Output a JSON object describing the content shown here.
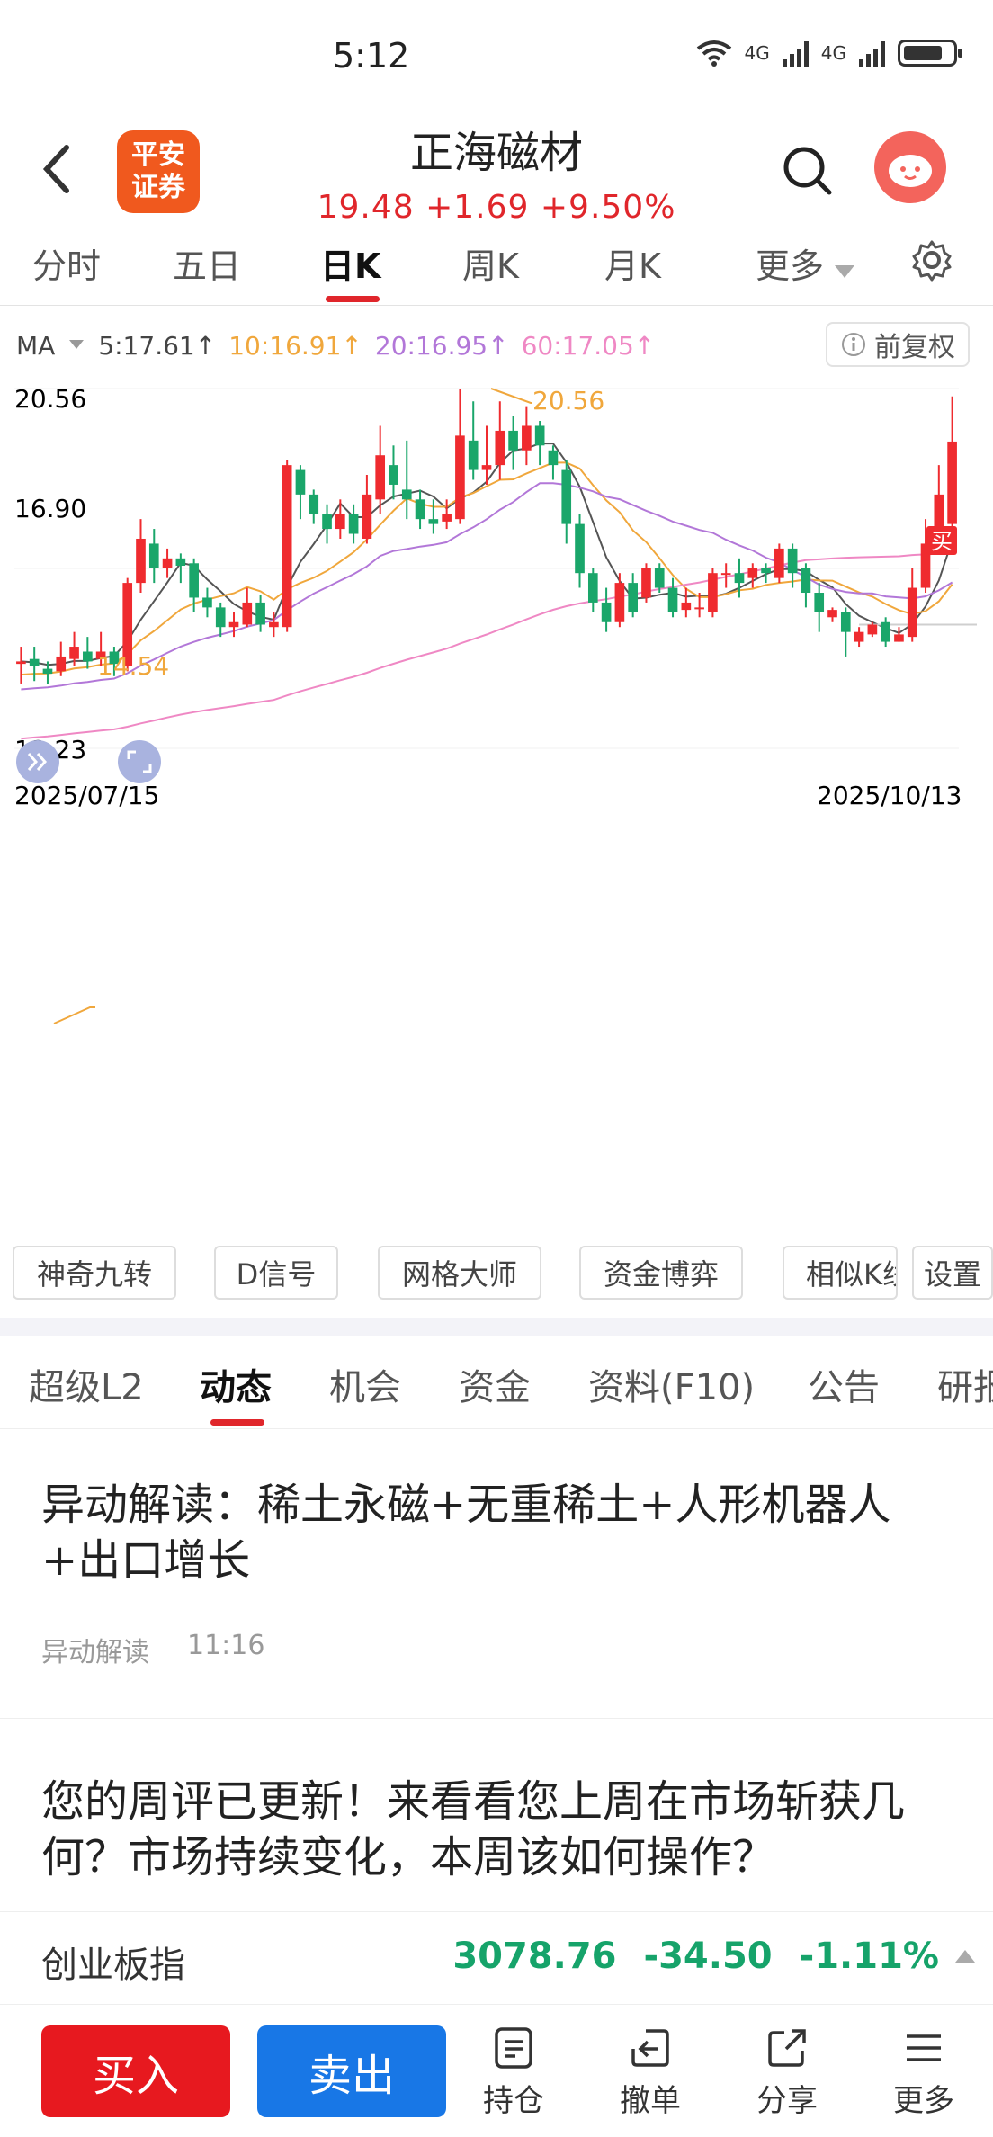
{
  "status_bar": {
    "time": "5:12",
    "net1": "4G",
    "net2": "4G"
  },
  "header": {
    "logo_text_line1": "平安",
    "logo_text_line2": "证券",
    "stock_name": "正海磁材",
    "price": "19.48",
    "change": "+1.69",
    "change_pct": "+9.50%"
  },
  "period_tabs": [
    "分时",
    "五日",
    "日K",
    "周K",
    "月K",
    "更多"
  ],
  "ma_bar": {
    "label": "MA",
    "ma5": "5:17.61↑",
    "ma10": "10:16.91↑",
    "ma20": "20:16.95↑",
    "ma60": "60:17.05↑",
    "fuquan": "前复权",
    "colors": {
      "ma5": "#555555",
      "ma10": "#f0a73c",
      "ma20": "#b277d8",
      "ma60": "#ef88c4"
    }
  },
  "chart_data": {
    "type": "candlestick",
    "title": "",
    "x_start": "2025/07/15",
    "x_end": "2025/10/13",
    "ylim": [
      13.23,
      20.56
    ],
    "y_ticks": [
      "20.56",
      "16.90",
      "13.23"
    ],
    "annotations": {
      "high": "20.56",
      "low": "14.54",
      "buy_marker": "买"
    },
    "colors": {
      "up": "#ef2b2f",
      "down": "#1aa66a"
    },
    "candles": [
      [
        14.95,
        15.0,
        14.55,
        15.3
      ],
      [
        15.05,
        14.9,
        14.6,
        15.3
      ],
      [
        14.85,
        14.75,
        14.54,
        15.0
      ],
      [
        14.8,
        15.1,
        14.7,
        15.4
      ],
      [
        15.05,
        15.3,
        14.9,
        15.6
      ],
      [
        15.2,
        15.0,
        14.85,
        15.5
      ],
      [
        15.05,
        15.2,
        14.9,
        15.6
      ],
      [
        15.2,
        14.95,
        14.7,
        15.3
      ],
      [
        14.9,
        16.6,
        14.8,
        16.7
      ],
      [
        16.6,
        17.5,
        16.4,
        17.9
      ],
      [
        17.4,
        16.9,
        16.6,
        17.7
      ],
      [
        16.9,
        17.1,
        16.7,
        17.3
      ],
      [
        17.1,
        16.95,
        16.6,
        17.2
      ],
      [
        17.0,
        16.3,
        16.0,
        17.1
      ],
      [
        16.3,
        16.1,
        15.9,
        16.5
      ],
      [
        16.1,
        15.7,
        15.5,
        16.2
      ],
      [
        15.7,
        15.8,
        15.5,
        16.0
      ],
      [
        15.75,
        16.2,
        15.7,
        16.5
      ],
      [
        16.2,
        15.75,
        15.6,
        16.35
      ],
      [
        15.7,
        15.8,
        15.5,
        16.0
      ],
      [
        15.7,
        19.0,
        15.6,
        19.1
      ],
      [
        18.9,
        18.4,
        17.9,
        19.0
      ],
      [
        18.4,
        18.0,
        17.8,
        18.5
      ],
      [
        18.0,
        17.7,
        17.4,
        18.2
      ],
      [
        17.7,
        18.0,
        17.5,
        18.3
      ],
      [
        18.0,
        17.6,
        17.4,
        18.2
      ],
      [
        17.5,
        18.4,
        17.4,
        18.8
      ],
      [
        18.3,
        19.2,
        18.0,
        19.8
      ],
      [
        19.0,
        18.6,
        18.3,
        19.4
      ],
      [
        18.5,
        18.3,
        17.9,
        19.5
      ],
      [
        18.3,
        17.9,
        17.7,
        18.5
      ],
      [
        17.9,
        17.8,
        17.6,
        18.3
      ],
      [
        17.85,
        18.0,
        17.7,
        18.3
      ],
      [
        17.9,
        19.6,
        17.8,
        20.56
      ],
      [
        19.5,
        18.9,
        18.7,
        20.3
      ],
      [
        18.9,
        19.0,
        18.6,
        19.8
      ],
      [
        19.0,
        19.7,
        18.7,
        20.3
      ],
      [
        19.7,
        19.3,
        18.9,
        20.0
      ],
      [
        19.3,
        19.8,
        19.0,
        20.2
      ],
      [
        19.8,
        19.4,
        19.0,
        19.9
      ],
      [
        19.3,
        19.0,
        18.7,
        19.4
      ],
      [
        18.9,
        17.8,
        17.4,
        19.1
      ],
      [
        17.8,
        16.8,
        16.5,
        18.0
      ],
      [
        16.8,
        16.2,
        16.0,
        16.9
      ],
      [
        16.2,
        15.8,
        15.6,
        16.5
      ],
      [
        15.8,
        16.6,
        15.7,
        16.8
      ],
      [
        16.6,
        16.0,
        15.9,
        16.8
      ],
      [
        16.3,
        16.9,
        16.2,
        17.0
      ],
      [
        16.9,
        16.5,
        16.4,
        17.0
      ],
      [
        16.5,
        16.0,
        15.9,
        16.7
      ],
      [
        16.05,
        16.2,
        15.9,
        16.5
      ],
      [
        16.1,
        16.1,
        15.9,
        16.4
      ],
      [
        16.0,
        16.8,
        15.9,
        16.9
      ],
      [
        16.8,
        16.8,
        16.5,
        17.0
      ],
      [
        16.8,
        16.6,
        16.3,
        17.1
      ],
      [
        16.7,
        16.9,
        16.5,
        17.0
      ],
      [
        16.9,
        16.8,
        16.6,
        17.0
      ],
      [
        16.7,
        17.3,
        16.6,
        17.4
      ],
      [
        17.3,
        16.8,
        16.5,
        17.4
      ],
      [
        16.9,
        16.4,
        16.1,
        17.0
      ],
      [
        16.4,
        16.0,
        15.6,
        16.6
      ],
      [
        15.9,
        16.05,
        15.8,
        16.1
      ],
      [
        16.0,
        15.6,
        15.1,
        16.1
      ],
      [
        15.4,
        15.6,
        15.3,
        15.7
      ],
      [
        15.55,
        15.75,
        15.5,
        15.8
      ],
      [
        15.8,
        15.4,
        15.3,
        15.9
      ],
      [
        15.4,
        15.55,
        15.4,
        15.7
      ],
      [
        15.5,
        16.5,
        15.4,
        16.9
      ],
      [
        16.5,
        17.4,
        16.4,
        17.9
      ],
      [
        17.4,
        18.4,
        17.3,
        19.0
      ],
      [
        17.8,
        19.48,
        17.6,
        20.4
      ]
    ]
  },
  "chart_tools": [
    "神奇九转",
    "D信号",
    "网格大师",
    "资金博弈",
    "相似K线",
    "设置"
  ],
  "content_tabs": [
    "超级L2",
    "动态",
    "机会",
    "资金",
    "资料(F10)",
    "公告",
    "研报"
  ],
  "news": [
    {
      "title": "异动解读：稀土永磁+无重稀土+人形机器人+出口增长",
      "source": "异动解读",
      "time": "11:16"
    },
    {
      "title": "您的周评已更新！来看看您上周在市场斩获几何？市场持续变化，本周该如何操作？"
    }
  ],
  "ticker": {
    "name": "创业板指",
    "value": "3078.76",
    "change": "-34.50",
    "pct": "-1.11%"
  },
  "bottom_bar": {
    "buy": "买入",
    "sell": "卖出",
    "hold": "持仓",
    "cancel": "撤单",
    "share": "分享",
    "more": "更多"
  }
}
